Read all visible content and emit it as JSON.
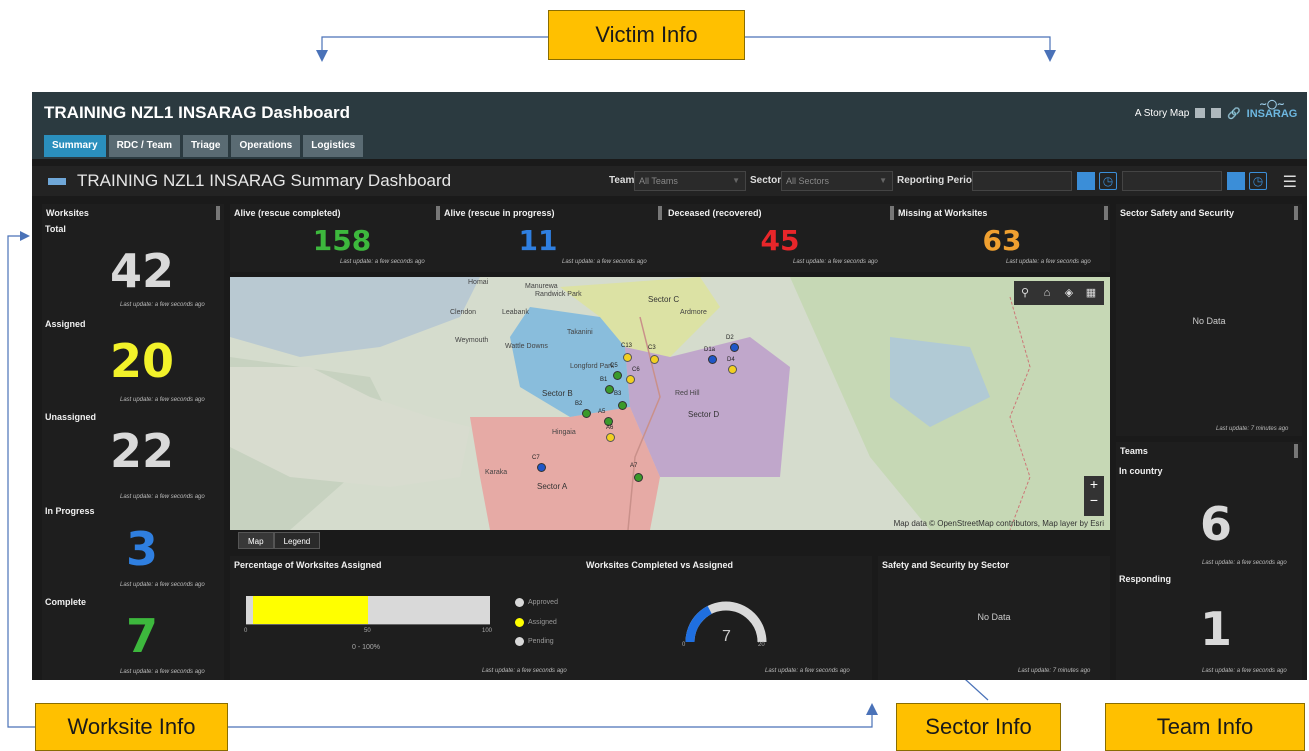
{
  "callouts": {
    "victim": "Victim Info",
    "worksite": "Worksite Info",
    "sector": "Sector Info",
    "team": "Team Info"
  },
  "app": {
    "title": "TRAINING NZL1 INSARAG Dashboard",
    "tabs": [
      "Summary",
      "RDC / Team",
      "Triage",
      "Operations",
      "Logistics"
    ],
    "active_tab": "Summary",
    "story_map": "A Story Map",
    "logo_text": "INSARAG",
    "dashboard_title": "TRAINING NZL1 INSARAG Summary Dashboard",
    "filters": {
      "team_label": "Team",
      "team_value": "All Teams",
      "sector_label": "Sector",
      "sector_value": "All Sectors",
      "reporting_label": "Reporting Period"
    }
  },
  "worksites": {
    "title": "Worksites",
    "items": [
      {
        "label": "Total",
        "value": "42",
        "color": "#d9d9d9",
        "updated": "Last update: a few seconds ago"
      },
      {
        "label": "Assigned",
        "value": "20",
        "color": "#f2f22a",
        "updated": "Last update: a few seconds ago"
      },
      {
        "label": "Unassigned",
        "value": "22",
        "color": "#d9d9d9",
        "updated": "Last update: a few seconds ago"
      },
      {
        "label": "In Progress",
        "value": "3",
        "color": "#2f7fe0",
        "updated": "Last update: a few seconds ago"
      },
      {
        "label": "Complete",
        "value": "7",
        "color": "#3db83d",
        "updated": "Last update: a few seconds ago"
      }
    ]
  },
  "victims": [
    {
      "title": "Alive (rescue completed)",
      "value": "158",
      "color": "#3db83d",
      "updated": "Last update: a few seconds ago"
    },
    {
      "title": "Alive (rescue in progress)",
      "value": "11",
      "color": "#2f7fe0",
      "updated": "Last update: a few seconds ago"
    },
    {
      "title": "Deceased (recovered)",
      "value": "45",
      "color": "#e8262a",
      "updated": "Last update: a few seconds ago"
    },
    {
      "title": "Missing at Worksites",
      "value": "63",
      "color": "#f0a030",
      "updated": "Last update: a few seconds ago"
    }
  ],
  "map": {
    "places": [
      "Homai",
      "Manurewa",
      "Randwick Park",
      "Clendon",
      "Leabank",
      "Sector C",
      "Ardmore",
      "Weymouth",
      "Wattle Downs",
      "Takanini",
      "Longford Park",
      "Sector B",
      "Red Hill",
      "Sector D",
      "Hingaia",
      "Karaka",
      "Sector A"
    ],
    "markers": [
      "C13",
      "C3",
      "C5",
      "C6",
      "D1a",
      "D2",
      "D4",
      "B1",
      "B2",
      "B3",
      "A5",
      "A6",
      "A7",
      "C7"
    ],
    "attribution": "Map data © OpenStreetMap contributors, Map layer by Esri",
    "tabs": [
      "Map",
      "Legend"
    ],
    "active_tab": "Map"
  },
  "pct_assigned": {
    "title": "Percentage of Worksites Assigned",
    "gradient_from": 0.03,
    "gradient_to": 0.5,
    "ticks": [
      "0",
      "50",
      "100"
    ],
    "range_label": "0 - 100%",
    "legend": [
      {
        "label": "Approved",
        "color": "#d9d9d9"
      },
      {
        "label": "Assigned",
        "color": "#ffff00"
      },
      {
        "label": "Pending",
        "color": "#d9d9d9"
      }
    ],
    "updated": "Last update: a few seconds ago"
  },
  "completed_vs_assigned": {
    "title": "Worksites Completed vs Assigned",
    "value": "7",
    "min": "0",
    "max": "20",
    "fraction": 0.35,
    "updated": "Last update: a few seconds ago"
  },
  "safety_by_sector": {
    "title": "Safety and Security by Sector",
    "no_data": "No Data",
    "updated": "Last update: 7 minutes ago"
  },
  "sector_safety": {
    "title": "Sector Safety and Security",
    "no_data": "No Data",
    "updated": "Last update: 7 minutes ago"
  },
  "teams": {
    "title": "Teams",
    "items": [
      {
        "label": "In country",
        "value": "6",
        "updated": "Last update: a few seconds ago"
      },
      {
        "label": "Responding",
        "value": "1",
        "updated": "Last update: a few seconds ago"
      }
    ]
  }
}
